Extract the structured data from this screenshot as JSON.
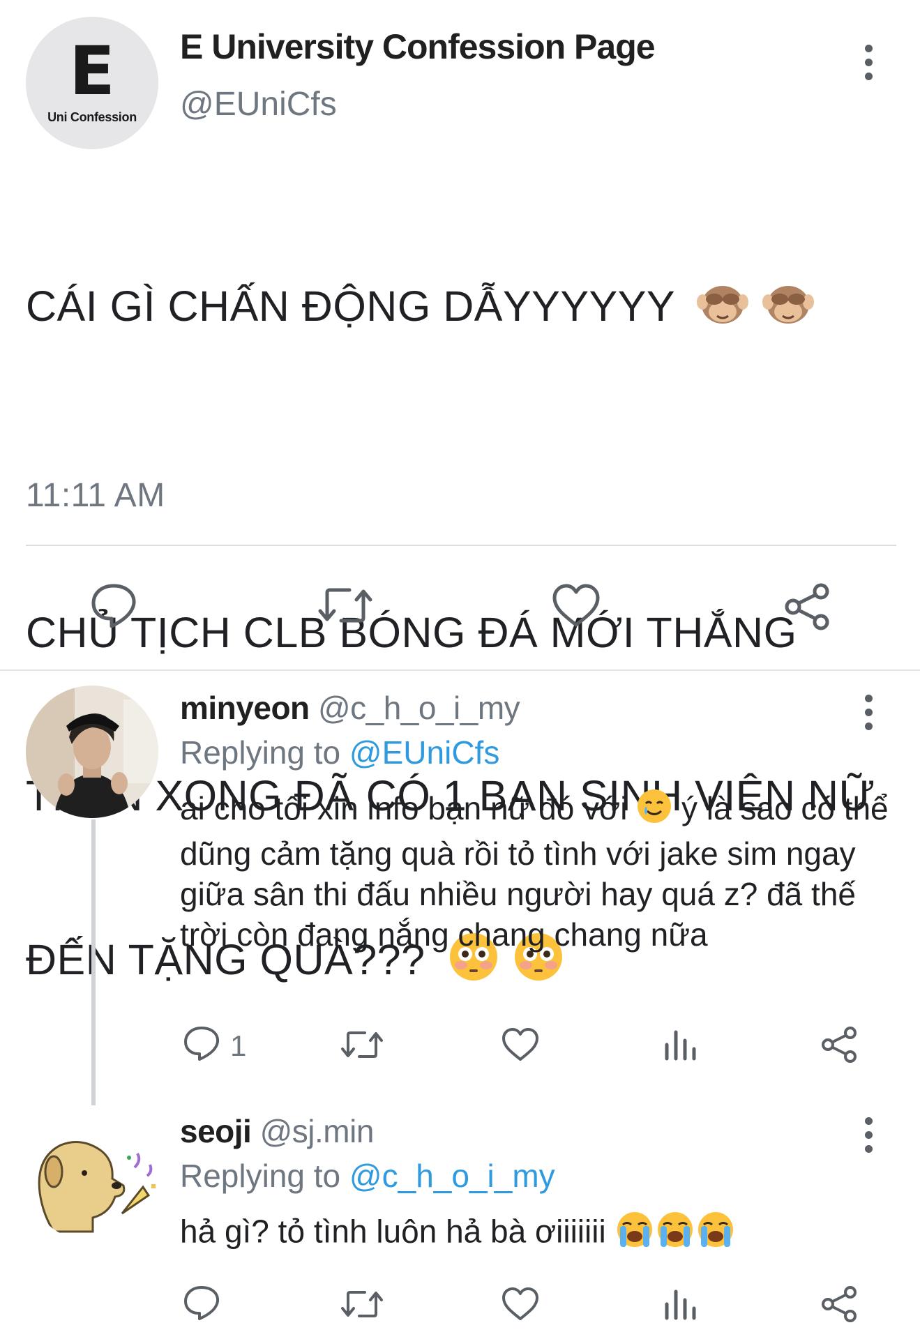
{
  "main_tweet": {
    "avatar_letter": "E",
    "avatar_caption": "Uni Confession",
    "display_name": "E University Confession Page",
    "handle": "@EUniCfs",
    "text_line1": "CÁI GÌ CHẤN ĐỘNG DẪYYYYYY",
    "text_line2": "CHỦ TỊCH CLB BÓNG ĐÁ MỚI THẮNG",
    "text_line3": "TRẬN XONG ĐÃ CÓ 1 BẠN SINH VIÊN NỮ",
    "text_line4": "ĐẾN TẶNG QUÀ???",
    "time": "11:11 AM",
    "actions": [
      "reply-icon",
      "retweet-icon",
      "like-icon",
      "share-icon"
    ]
  },
  "replies": [
    {
      "display_name": "minyeon",
      "handle": "@c_h_o_i_my",
      "replying_prefix": "Replying to",
      "replying_to": "@EUniCfs",
      "text_a": "ai cho tôi xin info bạn nữ đó với",
      "text_b": "ý là sao",
      "text_rest": "có thể dũng cảm tặng quà rồi tỏ tình với jake sim ngay giữa sân thi đấu nhiều người hay quá z? đã thế trời còn đang nắng chang chang nữa",
      "reply_count": "1"
    },
    {
      "display_name": "seoji",
      "handle": "@sj.min",
      "replying_prefix": "Replying to",
      "replying_to": "@c_h_o_i_my",
      "text": "hả gì? tỏ tình luôn hả bà ơiiiiiii"
    }
  ],
  "colors": {
    "link": "#2f9bde",
    "muted": "#6e7680",
    "icon": "#5a5f66"
  }
}
